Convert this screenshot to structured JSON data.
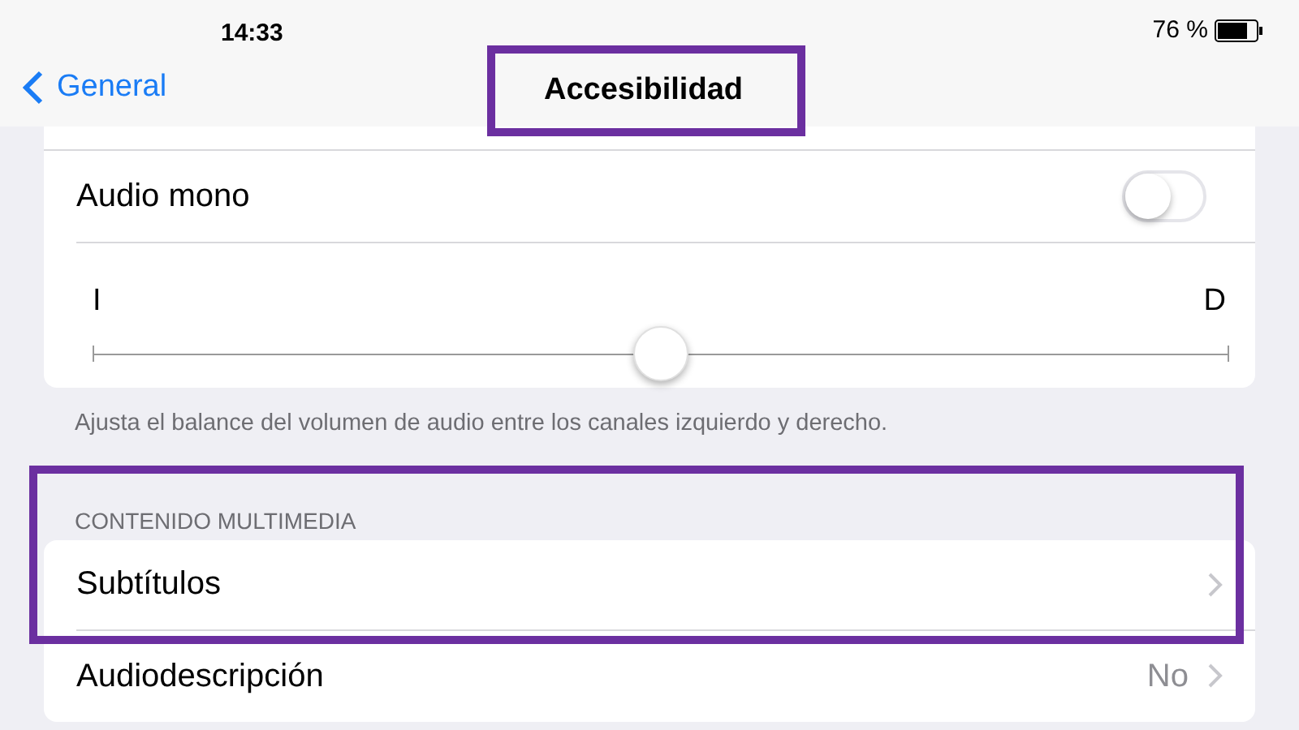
{
  "status_bar": {
    "time": "14:33",
    "battery": "76 %"
  },
  "nav": {
    "back": "General",
    "title": "Accesibilidad",
    "highlighted": true
  },
  "audio": {
    "mono": {
      "label": "Audio mono",
      "on": false
    },
    "balance": {
      "left": "I",
      "right": "D",
      "level": 0.5
    },
    "footer": "Ajusta el balance del volumen de audio entre los canales izquierdo y derecho."
  },
  "multimedia": {
    "header": "CONTENIDO MULTIMEDIA",
    "highlighted": true,
    "rows": [
      {
        "label": "Subtítulos"
      },
      {
        "label": "Audiodescripción",
        "value": "No"
      }
    ]
  }
}
